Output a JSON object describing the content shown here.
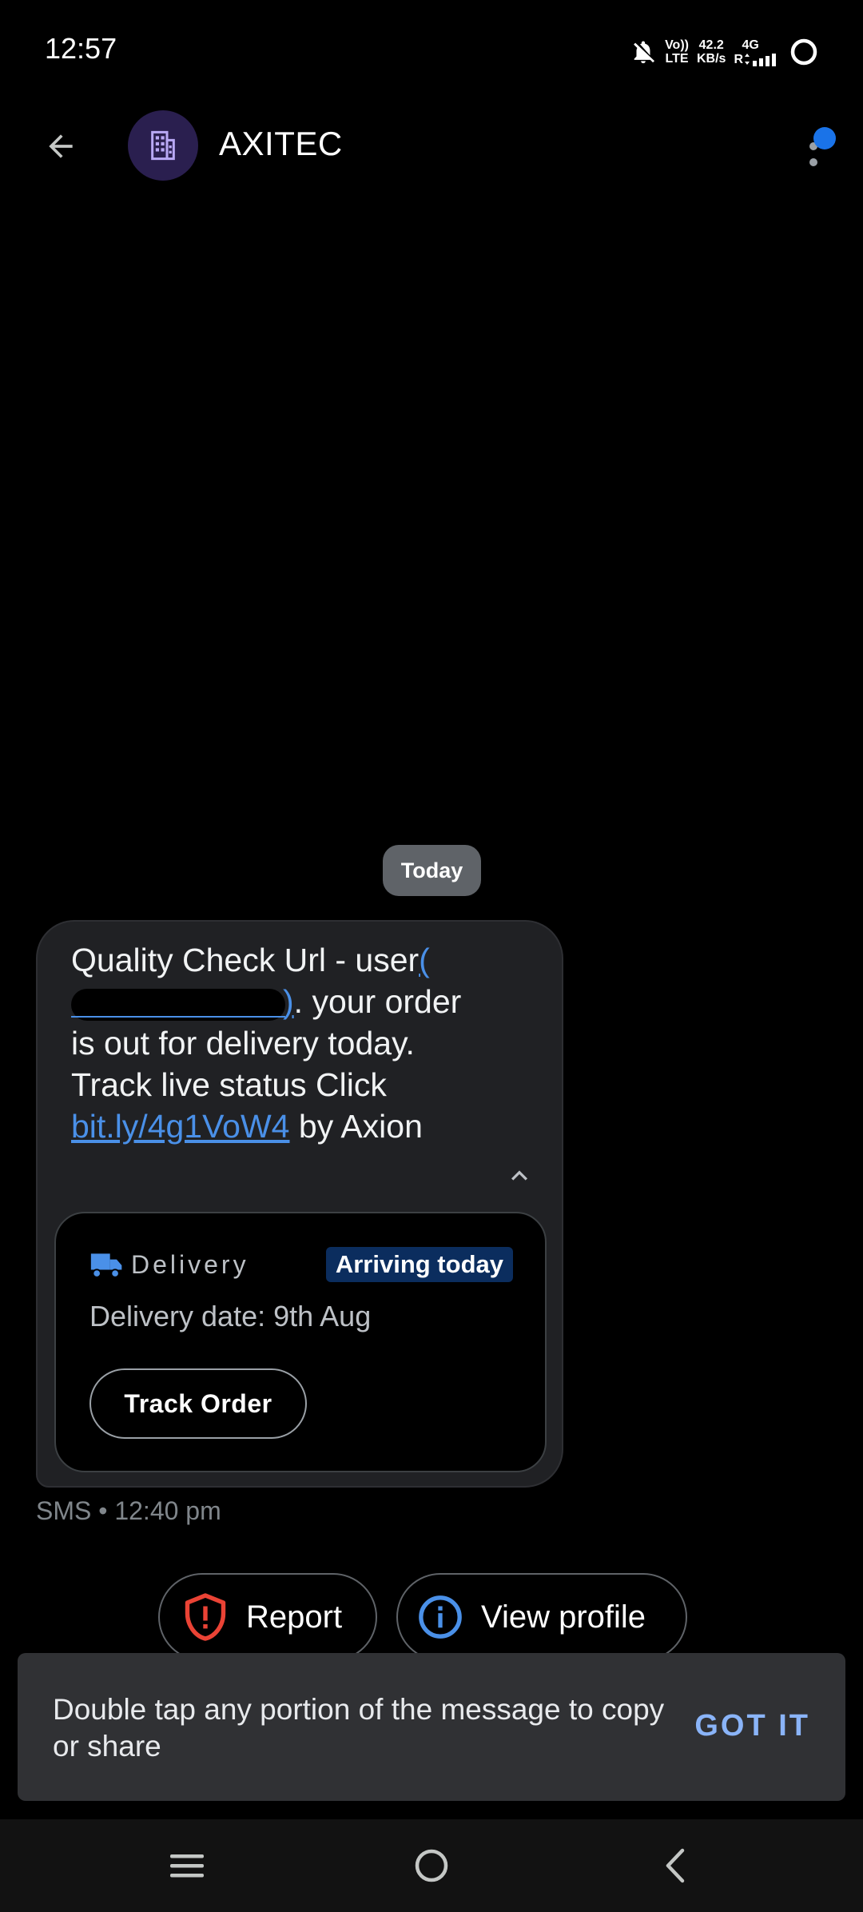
{
  "status_bar": {
    "time": "12:57",
    "volte_top": "Vo))",
    "volte_bottom": "LTE",
    "speed_value": "42.2",
    "speed_unit": "KB/s",
    "network_top": "4G",
    "network_bottom": "R"
  },
  "header": {
    "contact_name": "AXITEC"
  },
  "thread": {
    "date_chip": "Today",
    "message": {
      "text_part1": "Quality Check Url - user",
      "link_open": "(",
      "text_part2": ". your order is out for delivery today. Track live status Click ",
      "link": "bit.ly/4g1VoW4",
      "text_part3": " by Axion"
    },
    "delivery_card": {
      "label": "Delivery",
      "badge": "Arriving today",
      "date": "Delivery date: 9th Aug",
      "track_button": "Track Order"
    },
    "meta": "SMS • 12:40 pm"
  },
  "actions": {
    "report": "Report",
    "view_profile": "View profile"
  },
  "snackbar": {
    "text": "Double tap any portion of the message to copy or share",
    "action": "GOT IT"
  },
  "colors": {
    "background": "#000000",
    "bubble": "#202124",
    "link": "#4a90e8",
    "accent": "#1a73e8",
    "badge": "#0b2d5e",
    "report_icon": "#ea4335",
    "snack_action": "#8ab4f8"
  }
}
